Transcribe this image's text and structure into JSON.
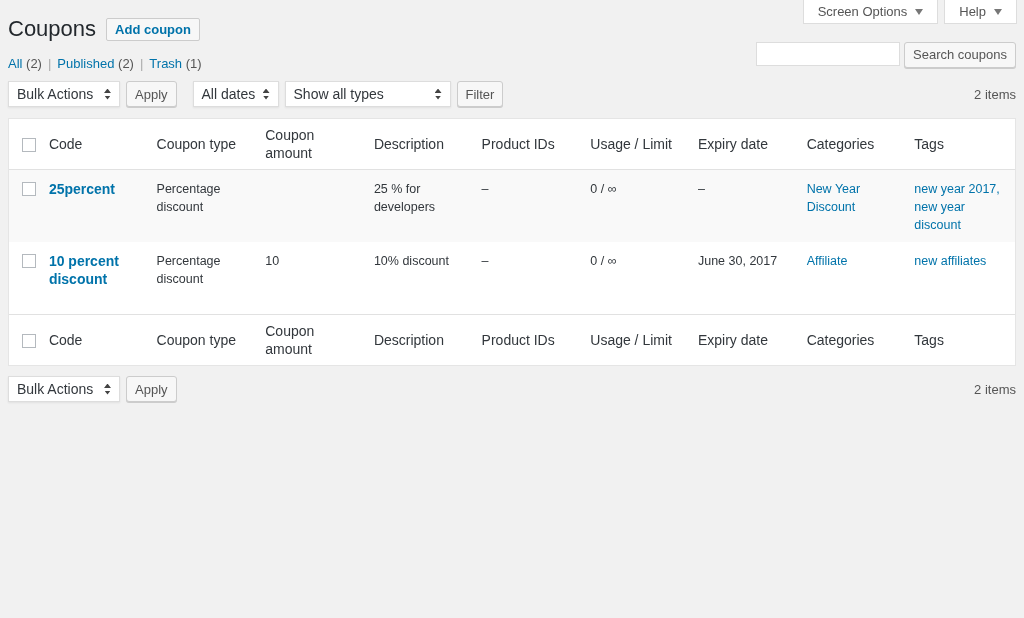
{
  "screen_meta": {
    "screen_options": "Screen Options",
    "help": "Help"
  },
  "heading": {
    "title": "Coupons",
    "add_button": "Add coupon"
  },
  "views": [
    {
      "label": "All",
      "count": "(2)"
    },
    {
      "separator": "|",
      "label": "Published",
      "count": "(2)"
    },
    {
      "separator": "|",
      "label": "Trash",
      "count": "(1)"
    }
  ],
  "search": {
    "button": "Search coupons"
  },
  "top_nav": {
    "bulk_action": "Bulk Actions",
    "apply": "Apply",
    "date_filter": "All dates",
    "type_filter": "Show all types",
    "filter": "Filter",
    "count": "2 items"
  },
  "table": {
    "select_all_checked": false,
    "columns": [
      "Code",
      "Coupon type",
      "Coupon amount",
      "Description",
      "Product IDs",
      "Usage / Limit",
      "Expiry date",
      "Categories",
      "Tags"
    ],
    "rows": [
      {
        "checked": false,
        "code": "25percent",
        "type": "Percentage discount",
        "description": "25 % for developers",
        "product_ids": "–",
        "usage": "0 / ∞",
        "expiry": "–",
        "categories": "New Year Discount",
        "tags": "new year 2017, new year discount"
      },
      {
        "checked": false,
        "code": "10 percent discount",
        "type": "Percentage discount",
        "amount": "10",
        "description": "10% discount",
        "product_ids": "–",
        "usage": "0 / ∞",
        "expiry": "June 30, 2017",
        "categories": "Affiliate",
        "tags": "new affiliates"
      }
    ],
    "footer_select_all_checked": false,
    "footer_columns": [
      "Code",
      "Coupon type",
      "Coupon amount",
      "Description",
      "Product IDs",
      "Usage / Limit",
      "Expiry date",
      "Categories",
      "Tags"
    ]
  },
  "bottom_nav": {
    "bulk_action": "Bulk Actions",
    "apply": "Apply",
    "count": "2 items"
  }
}
